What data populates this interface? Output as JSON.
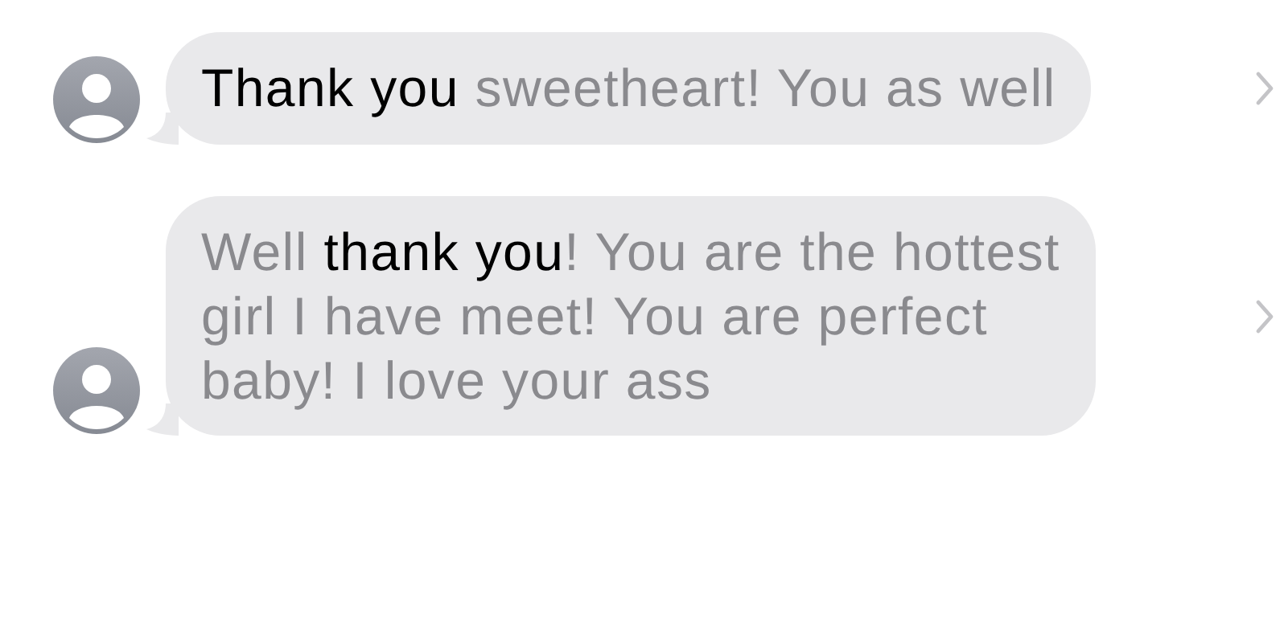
{
  "messages": [
    {
      "lines": [
        [
          {
            "text": "Thank you",
            "highlighted": true
          },
          {
            "text": " sweetheart! You as well",
            "highlighted": false
          }
        ]
      ]
    },
    {
      "lines": [
        [
          {
            "text": "Well ",
            "highlighted": false
          },
          {
            "text": "thank you",
            "highlighted": true
          },
          {
            "text": "! You are the hottest",
            "highlighted": false
          }
        ],
        [
          {
            "text": "girl I have meet! You are perfect",
            "highlighted": false
          }
        ],
        [
          {
            "text": "baby! I love your ass",
            "highlighted": false
          }
        ]
      ]
    }
  ]
}
